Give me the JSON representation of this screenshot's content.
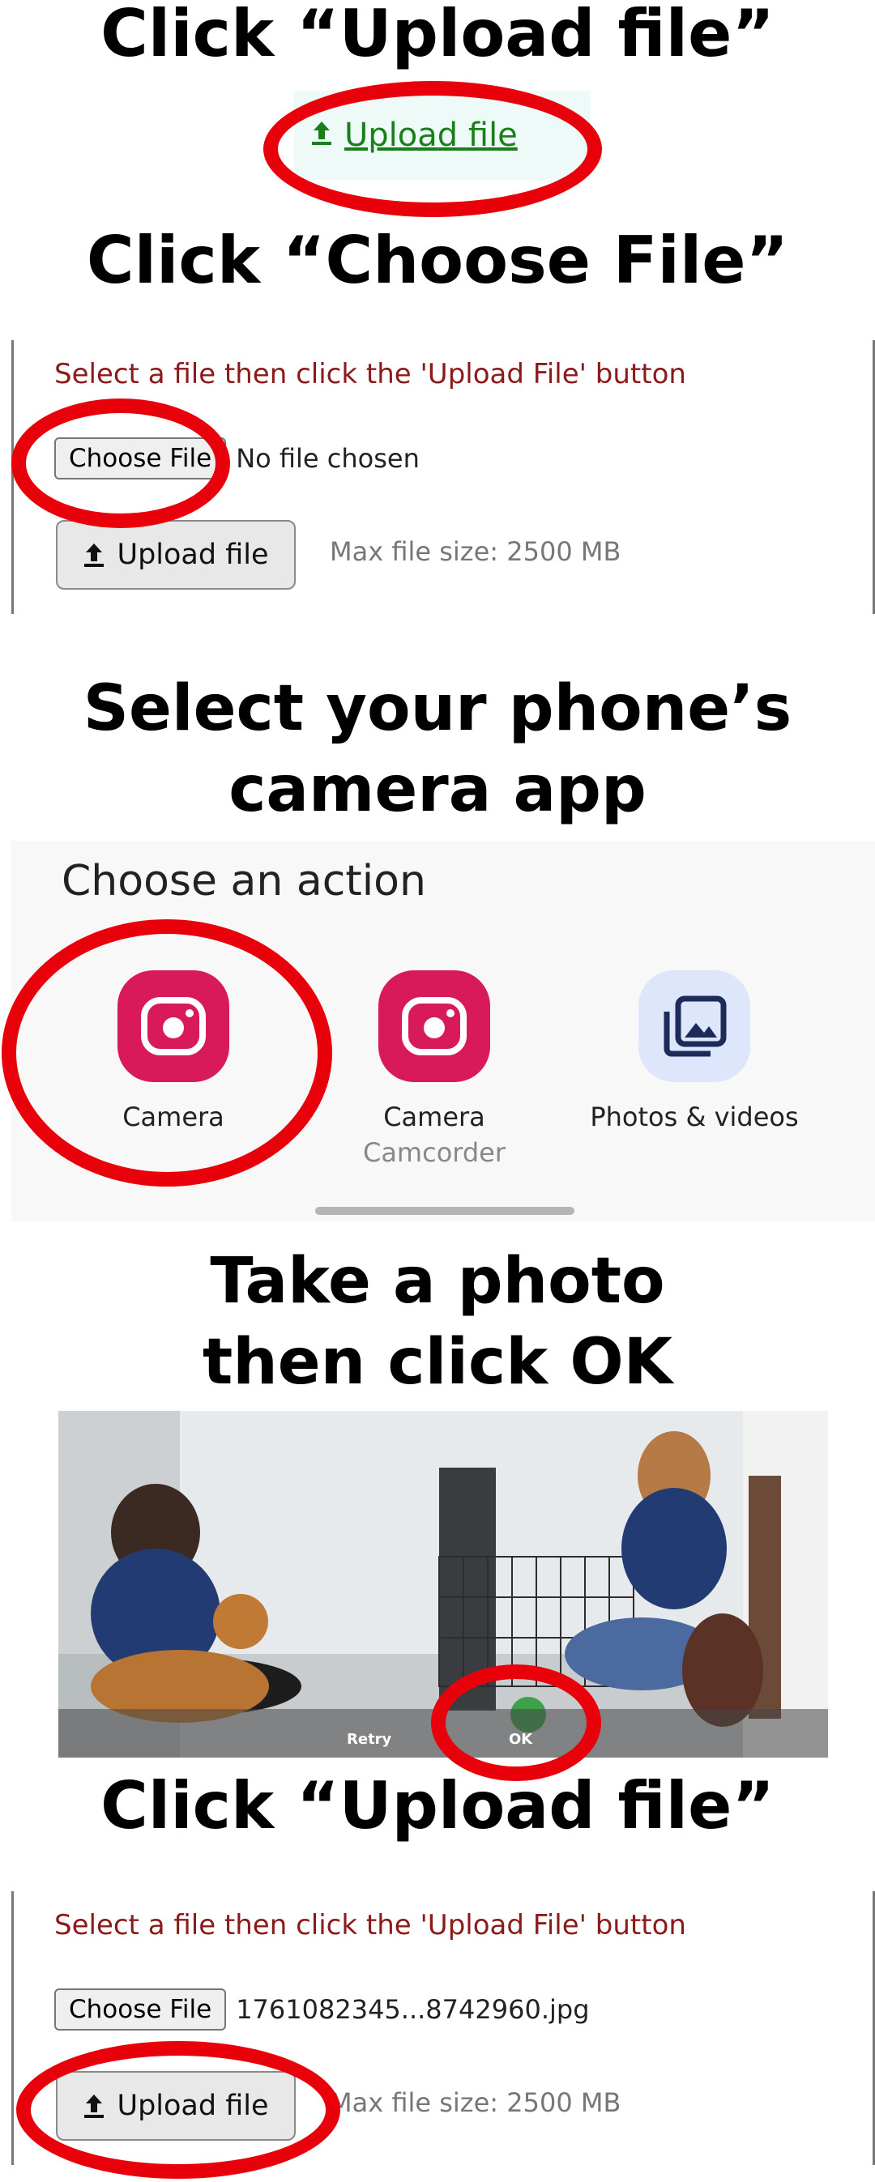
{
  "steps": {
    "step1_title": "Click “Upload file”",
    "step2_title": "Click “Choose File”",
    "step3_title_line1": "Select your phone’s",
    "step3_title_line2": "camera app",
    "step4_title_line1": "Take a photo",
    "step4_title_line2": "then click OK",
    "step5_title": "Click “Upload file”"
  },
  "upload_link": {
    "label": "Upload file",
    "icon": "upload-arrow-icon",
    "color": "#1a7f1a"
  },
  "form_before": {
    "hint": "Select a file then click the 'Upload File' button",
    "choose_label": "Choose File",
    "file_status": "No file chosen",
    "upload_label": "Upload file",
    "max_size": "Max file size: 2500 MB"
  },
  "action_sheet": {
    "title": "Choose an action",
    "apps": [
      {
        "label": "Camera",
        "sublabel": "",
        "icon": "camera-icon"
      },
      {
        "label": "Camera",
        "sublabel": "Camcorder",
        "icon": "camera-icon"
      },
      {
        "label": "Photos & videos",
        "sublabel": "",
        "icon": "photos-icon"
      }
    ]
  },
  "camera": {
    "retry_label": "Retry",
    "ok_label": "OK"
  },
  "form_after": {
    "hint": "Select a file then click the 'Upload File' button",
    "choose_label": "Choose File",
    "file_status": "1761082345...8742960.jpg",
    "upload_label": "Upload file",
    "max_size": "Max file size: 2500 MB"
  },
  "colors": {
    "highlight_ring": "#e8000b",
    "hint_text": "#8b1a1a",
    "camera_app": "#d91a5a"
  }
}
